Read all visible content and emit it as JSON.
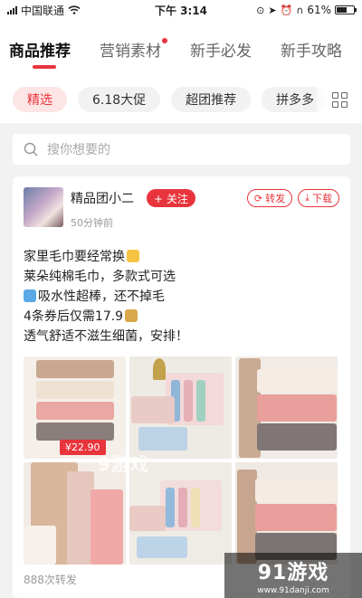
{
  "status_bar": {
    "carrier": "中国联通",
    "time": "下午 3:14",
    "battery": "61%",
    "battery_level": 0.61
  },
  "tabs": [
    {
      "label": "商品推荐",
      "active": true
    },
    {
      "label": "营销素材",
      "badge_dot": true
    },
    {
      "label": "新手必发"
    },
    {
      "label": "新手攻略"
    }
  ],
  "chips": [
    {
      "label": "精选",
      "active": true
    },
    {
      "label": "6.18大促"
    },
    {
      "label": "超团推荐"
    },
    {
      "label": "拼多多"
    }
  ],
  "search": {
    "placeholder": "搜你想要的"
  },
  "post": {
    "author": "精品团小二",
    "follow_label": "+ 关注",
    "time_ago": "50分钟前",
    "forward_label": "转发",
    "download_label": "下载",
    "lines": [
      "家里毛巾要经常换",
      "莱朵纯棉毛巾，多款式可选",
      "吸水性超棒，还不掉毛",
      "4条券后仅需17.9",
      "透气舒适不滋生细菌，安排！"
    ],
    "price_tag": "¥22.90",
    "forward_count": "888次转发"
  },
  "watermark": {
    "brand": "91游戏",
    "site": "www.91danji.com",
    "overlay": "9游戏"
  },
  "colors": {
    "accent": "#e8343c",
    "chip_active_bg": "#fde5e5"
  },
  "icons": [
    "wifi-icon",
    "signal-icon",
    "search-icon",
    "share-icon",
    "download-icon",
    "grid-icon"
  ]
}
